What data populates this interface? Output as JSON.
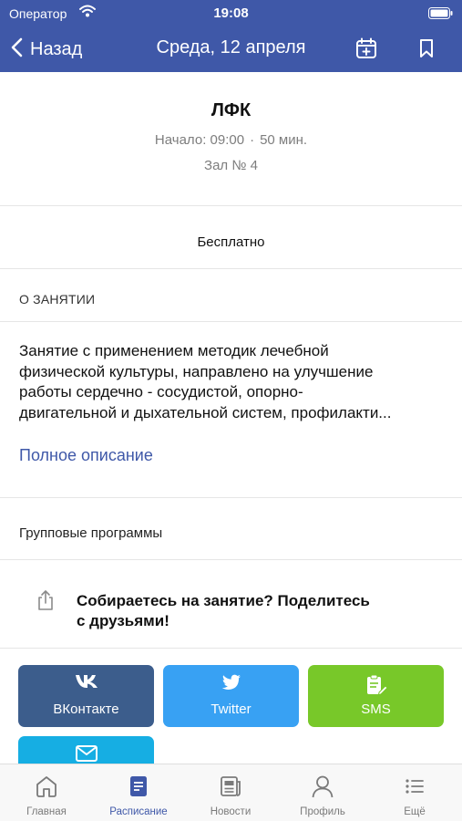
{
  "status_bar": {
    "carrier": "Оператор",
    "time": "19:08"
  },
  "nav": {
    "back_label": "Назад",
    "title": "Среда, 12 апреля",
    "bar_color": "#3f58a8"
  },
  "event": {
    "title": "ЛФК",
    "start": "Начало: 09:00",
    "duration": "50 мин.",
    "room": "Зал № 4",
    "price": "Бесплатно"
  },
  "about": {
    "header": "О ЗАНЯТИИ",
    "description_lines": [
      "Занятие с применением методик лечебной",
      "физической культуры, направлено на улучшение",
      "работы сердечно - сосудистой, опорно-",
      "двигательной и дыхательной систем, профилакти..."
    ],
    "full_link": "Полное описание"
  },
  "category": "Групповые программы",
  "share": {
    "prompt_line1": "Собираетесь на занятие? Поделитесь",
    "prompt_line2": "с друзьями!",
    "buttons": [
      {
        "label": "ВКонтакте",
        "icon": "vk-icon",
        "color": "#3c5d8c"
      },
      {
        "label": "Twitter",
        "icon": "twitter-icon",
        "color": "#38a1f3"
      },
      {
        "label": "SMS",
        "icon": "sms-icon",
        "color": "#78c829"
      },
      {
        "label": "",
        "icon": "email-icon",
        "color": "#16aee3"
      }
    ]
  },
  "tabs": [
    {
      "label": "Главная",
      "icon": "home-icon",
      "active": false
    },
    {
      "label": "Расписание",
      "icon": "schedule-icon",
      "active": true
    },
    {
      "label": "Новости",
      "icon": "news-icon",
      "active": false
    },
    {
      "label": "Профиль",
      "icon": "profile-icon",
      "active": false
    },
    {
      "label": "Ещё",
      "icon": "more-icon",
      "active": false
    }
  ],
  "colors": {
    "accent": "#3f58a8",
    "muted_text": "#7d7d7d"
  }
}
